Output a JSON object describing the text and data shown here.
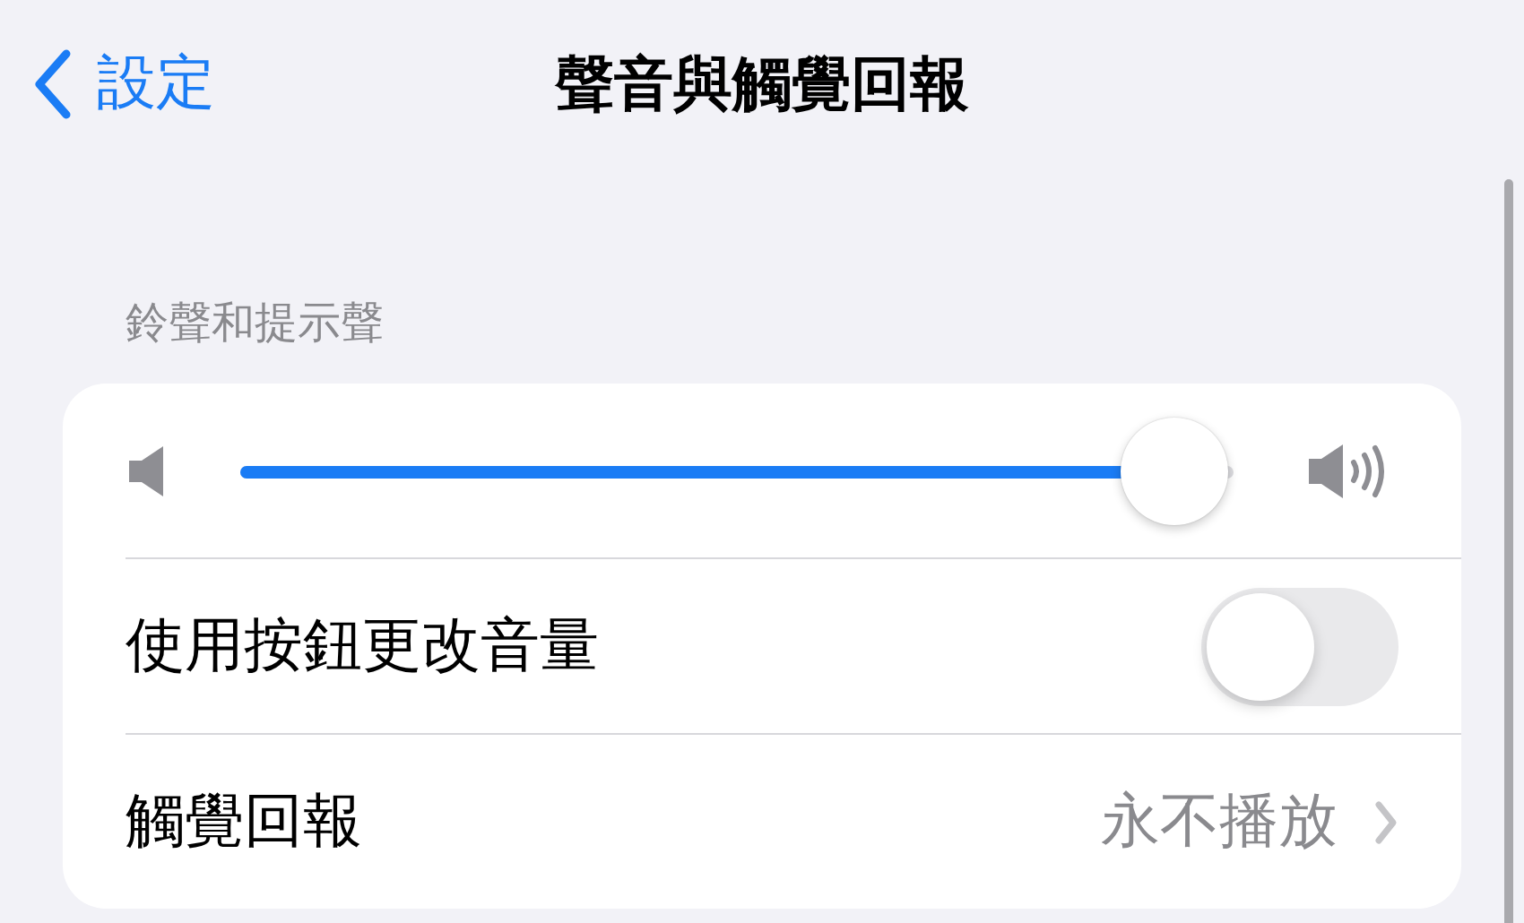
{
  "nav": {
    "back_label": "設定",
    "title": "聲音與觸覺回報"
  },
  "section": {
    "header": "鈴聲和提示聲",
    "rows": [
      {
        "kind": "slider",
        "level": 0.94
      },
      {
        "kind": "toggle",
        "label": "使用按鈕更改音量",
        "on": false
      },
      {
        "kind": "link",
        "label": "觸覺回報",
        "value": "永不播放"
      }
    ]
  }
}
